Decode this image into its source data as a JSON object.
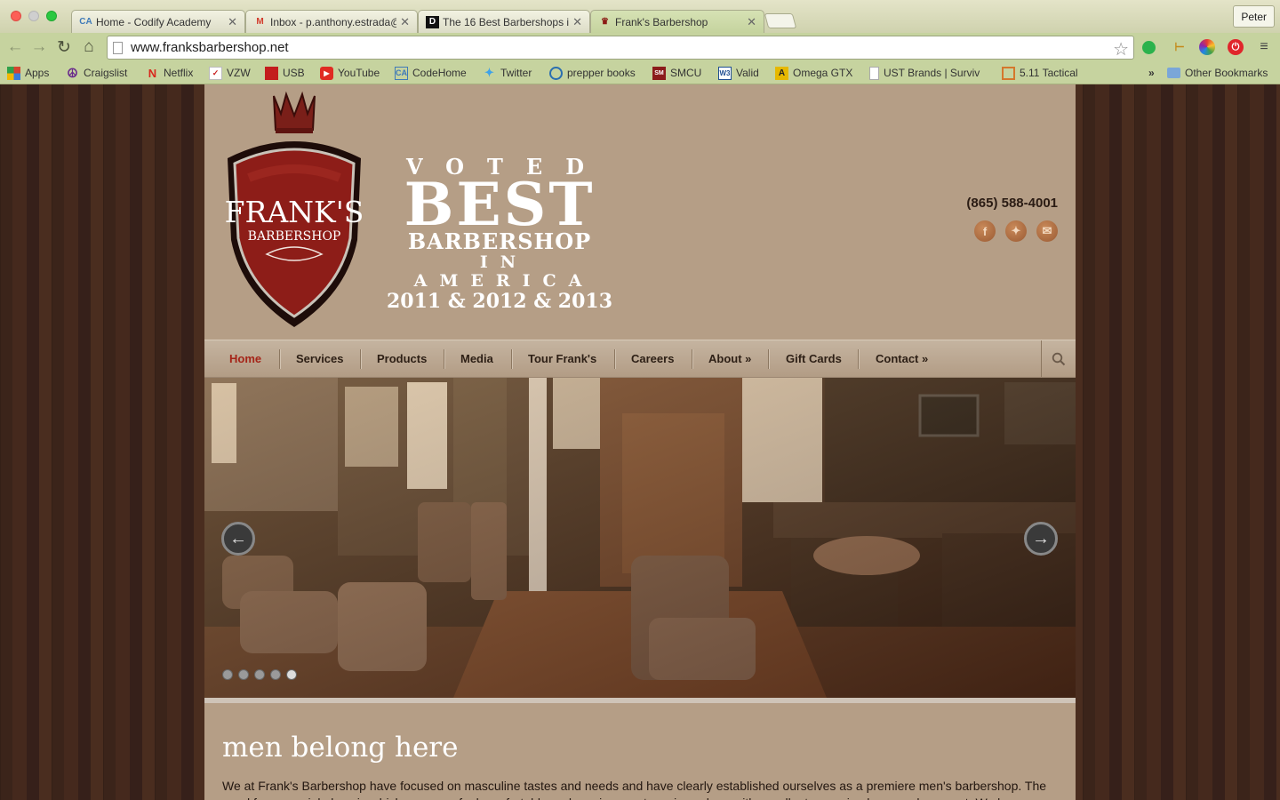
{
  "browser": {
    "tabs": [
      {
        "label": "Home - Codify Academy",
        "icon": "codify-favicon"
      },
      {
        "label": "Inbox - p.anthony.estrada@",
        "icon": "gmail-favicon"
      },
      {
        "label": "The 16 Best Barbershops i",
        "icon": "d-favicon"
      },
      {
        "label": "Frank's Barbershop",
        "icon": "crown-favicon"
      }
    ],
    "profile": "Peter",
    "url": "www.franksbarbershop.net",
    "bookmarks": [
      {
        "label": "Apps",
        "icon": "apps-grid-icon",
        "color": "#d6432f"
      },
      {
        "label": "Craigslist",
        "icon": "peace-icon",
        "color": "#6a2b8c"
      },
      {
        "label": "Netflix",
        "icon": "netflix-icon",
        "color": "#d9261c"
      },
      {
        "label": "VZW",
        "icon": "vzw-icon",
        "color": "#c81e1e"
      },
      {
        "label": "USB",
        "icon": "usb-icon",
        "color": "#c31d1d"
      },
      {
        "label": "YouTube",
        "icon": "youtube-icon",
        "color": "#e02b23"
      },
      {
        "label": "CodeHome",
        "icon": "codify-icon",
        "color": "#3f7ab8"
      },
      {
        "label": "Twitter",
        "icon": "twitter-icon",
        "color": "#3ea2e8"
      },
      {
        "label": "prepper books",
        "icon": "prepper-icon",
        "color": "#2b6fb0"
      },
      {
        "label": "SMCU",
        "icon": "smcu-icon",
        "color": "#8b1b1b"
      },
      {
        "label": "Valid",
        "icon": "w3-icon",
        "color": "#1e4d91"
      },
      {
        "label": "Omega GTX",
        "icon": "omega-icon",
        "color": "#e6b800"
      },
      {
        "label": "UST Brands | Surviv",
        "icon": "page-icon",
        "color": "#9a9a9a"
      },
      {
        "label": "5.11 Tactical",
        "icon": "tactical-icon",
        "color": "#d5772c"
      }
    ],
    "overflow": "»",
    "other_bookmarks": "Other Bookmarks"
  },
  "site": {
    "logo": {
      "name": "FRANK'S",
      "sub": "BARBERSHOP"
    },
    "award": {
      "line1": "VOTED",
      "line2": "BEST",
      "line3": "BARBERSHOP",
      "line4": "IN AMERICA",
      "line5": "2011 & 2012 & 2013"
    },
    "phone": "(865) 588-4001",
    "nav": [
      "Home",
      "Services",
      "Products",
      "Media",
      "Tour Frank's",
      "Careers",
      "About »",
      "Gift Cards",
      "Contact »"
    ],
    "headline": "men belong here",
    "intro": "We at Frank's Barbershop have focused on masculine tastes and needs and have clearly established ourselves as a premiere men's barbershop. The need for a special place in which guys can feel comfortable and receive great services along with excellent grooming has now been met. We know"
  },
  "colors": {
    "accent": "#a52418",
    "page_bg": "#b59e86",
    "wood_bg": "#3b241a",
    "chrome_bar": "#c6d39f"
  }
}
